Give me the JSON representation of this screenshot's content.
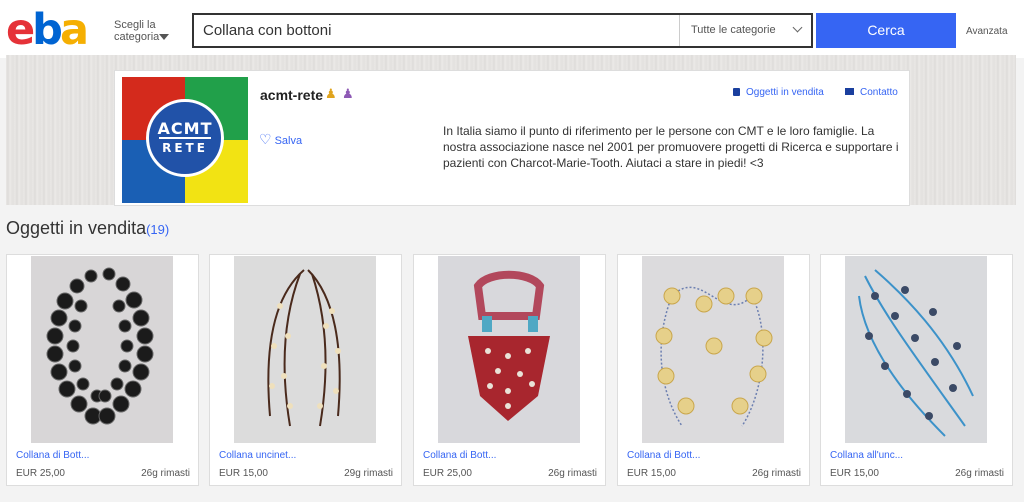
{
  "header": {
    "logo_letters": [
      "e",
      "b",
      "a",
      "y"
    ],
    "logo_colors": [
      "#e53238",
      "#0064d2",
      "#f5af02",
      "#86b817"
    ],
    "category_label": "Scegli la categoria",
    "search_value": "Collana con bottoni",
    "search_category": "Tutte le categorie",
    "search_button": "Cerca",
    "advanced": "Avanzata"
  },
  "store": {
    "logo_text_1": "ACMT",
    "logo_text_2": "RETE",
    "name": "acmt-rete",
    "save_label": "Salva",
    "link_items_for_sale": "Oggetti in vendita",
    "link_contact": "Contatto",
    "description": "In Italia siamo il punto di riferimento per le persone con CMT e le loro famiglie. La nostra associazione nasce nel 2001 per promuovere progetti di Ricerca e supportare i pazienti con Charcot-Marie-Tooth. Aiutaci a stare in piedi! <3"
  },
  "section": {
    "title": "Oggetti in vendita",
    "count": "(19)"
  },
  "listings": [
    {
      "title": "Collana di Bott...",
      "price": "EUR 25,00",
      "time_left": "26g rimasti"
    },
    {
      "title": "Collana uncinet...",
      "price": "EUR 15,00",
      "time_left": "29g rimasti"
    },
    {
      "title": "Collana di Bott...",
      "price": "EUR 25,00",
      "time_left": "26g rimasti"
    },
    {
      "title": "Collana di Bott...",
      "price": "EUR 15,00",
      "time_left": "26g rimasti"
    },
    {
      "title": "Collana all'unc...",
      "price": "EUR 15,00",
      "time_left": "26g rimasti"
    }
  ]
}
